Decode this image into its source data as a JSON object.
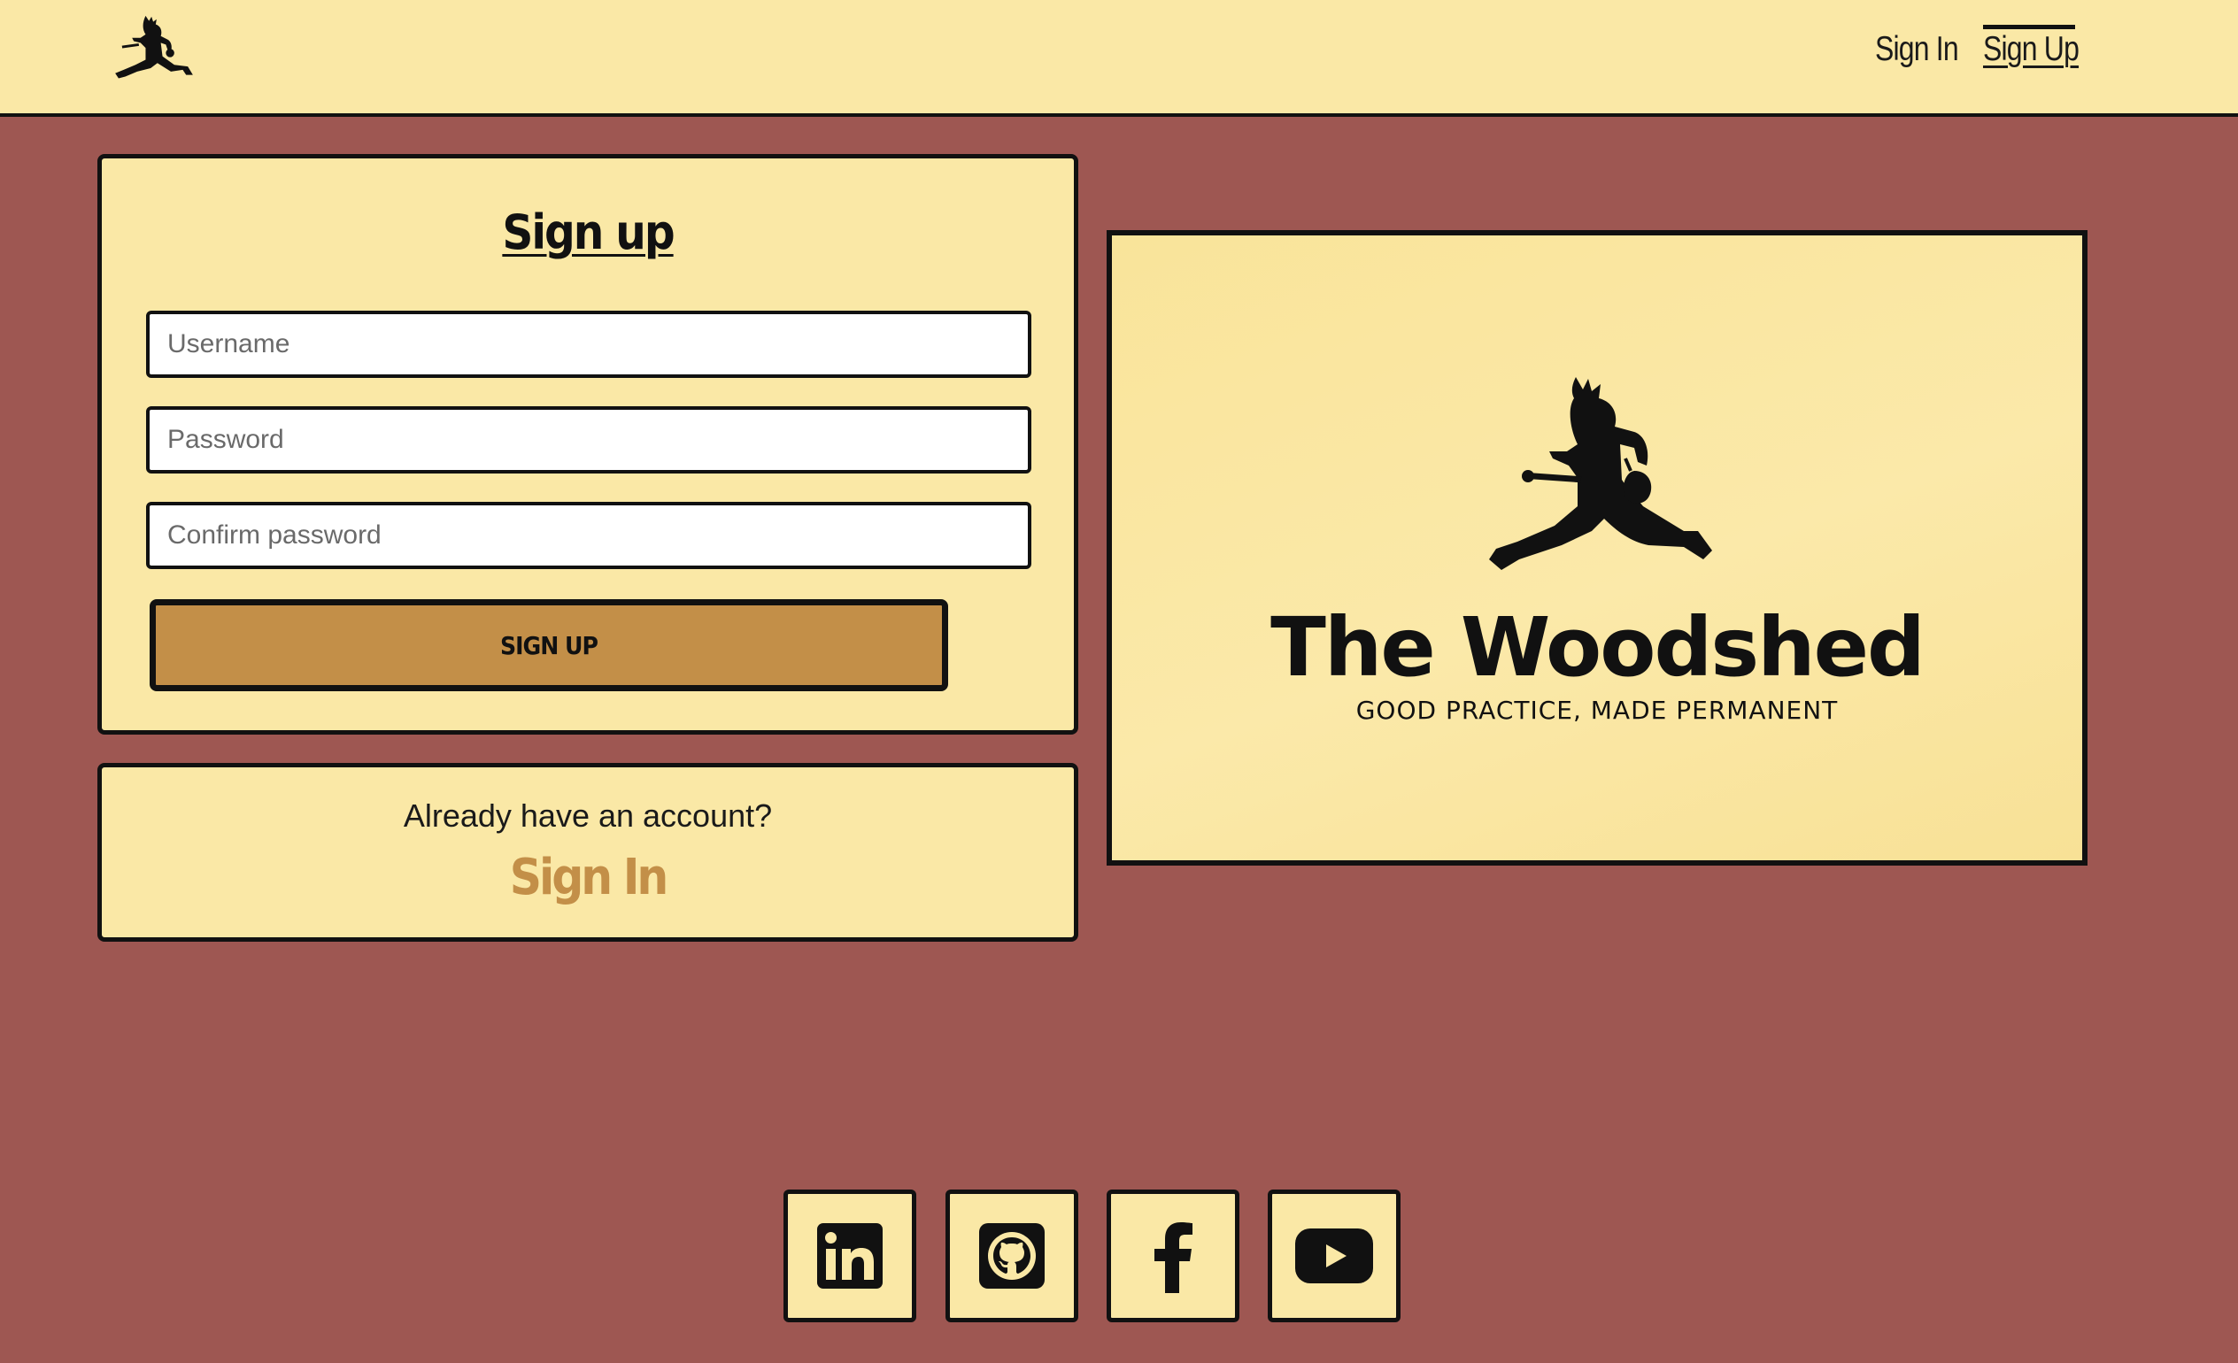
{
  "header": {
    "logo_icon": "woodshed-guitarist-logo-icon",
    "nav": {
      "signin_label": "Sign In",
      "signup_label": "Sign Up"
    }
  },
  "signup_form": {
    "title": "Sign up",
    "username_placeholder": "Username",
    "password_placeholder": "Password",
    "confirm_placeholder": "Confirm password",
    "submit_label": "SIGN UP"
  },
  "account_prompt": {
    "text": "Already have an account?",
    "signin_label": "Sign In"
  },
  "brand": {
    "name": "The Woodshed",
    "tagline": "GOOD PRACTICE, MADE PERMANENT",
    "figure_icon": "guitarist-silhouette-icon"
  },
  "social": [
    {
      "icon": "linkedin-icon"
    },
    {
      "icon": "github-icon"
    },
    {
      "icon": "facebook-icon"
    },
    {
      "icon": "youtube-icon"
    }
  ],
  "colors": {
    "background": "#9e5752",
    "cream": "#fae8a6",
    "accent": "#c38f48",
    "ink": "#111111"
  }
}
